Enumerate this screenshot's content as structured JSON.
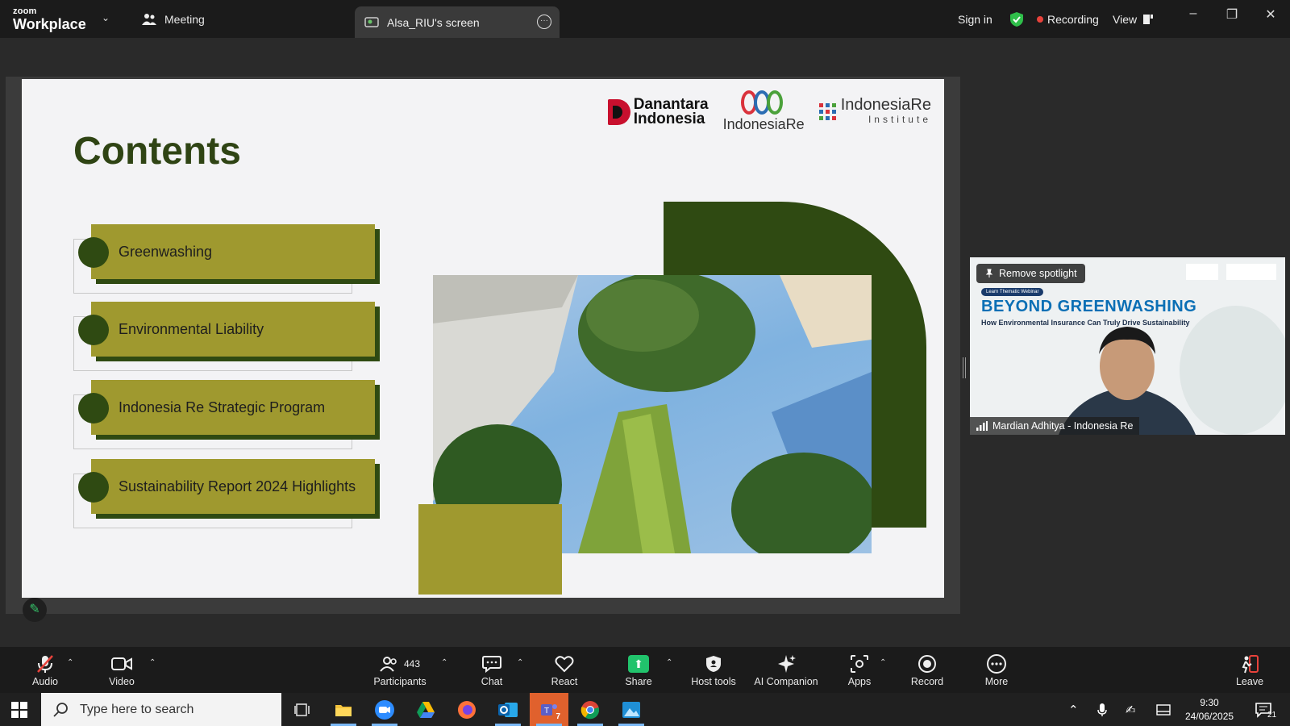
{
  "app": {
    "brand_small": "zoom",
    "brand_large": "Workplace"
  },
  "titlebar": {
    "meeting_tab": "Meeting",
    "screen_tab": "Alsa_RIU's screen",
    "sign_in": "Sign in",
    "recording": "Recording",
    "view": "View"
  },
  "slide": {
    "title": "Contents",
    "logos": {
      "danantara_line1": "Danantara",
      "danantara_line2": "Indonesia",
      "indonesiare": "IndonesiaRe",
      "institute_main": "IndonesiaRe",
      "institute_sub": "Institute"
    },
    "items": [
      {
        "label": "Greenwashing"
      },
      {
        "label": "Environmental Liability"
      },
      {
        "label": "Indonesia Re Strategic Program"
      },
      {
        "label": "Sustainability Report 2024 Highlights"
      }
    ]
  },
  "spotlight": {
    "remove_label": "Remove spotlight",
    "webinar_tag": "Learn Thematic Webinar",
    "title": "BEYOND GREENWASHING",
    "subtitle": "How Environmental Insurance Can Truly Drive Sustainability",
    "participant": "Mardian Adhitya - Indonesia Re"
  },
  "toolbar": {
    "audio": "Audio",
    "video": "Video",
    "participants": "Participants",
    "participants_count": "443",
    "chat": "Chat",
    "react": "React",
    "share": "Share",
    "host_tools": "Host tools",
    "ai_companion": "AI Companion",
    "apps": "Apps",
    "record": "Record",
    "more": "More",
    "leave": "Leave"
  },
  "taskbar": {
    "search_placeholder": "Type here to search",
    "time": "9:30",
    "date": "24/06/2025",
    "notification_count": "21",
    "teams_badge": "7"
  },
  "colors": {
    "slide_dark_green": "#2f4a12",
    "slide_olive": "#9f992f",
    "title_green": "#2f4414",
    "share_green": "#21c36c",
    "recording_red": "#e8423b"
  }
}
